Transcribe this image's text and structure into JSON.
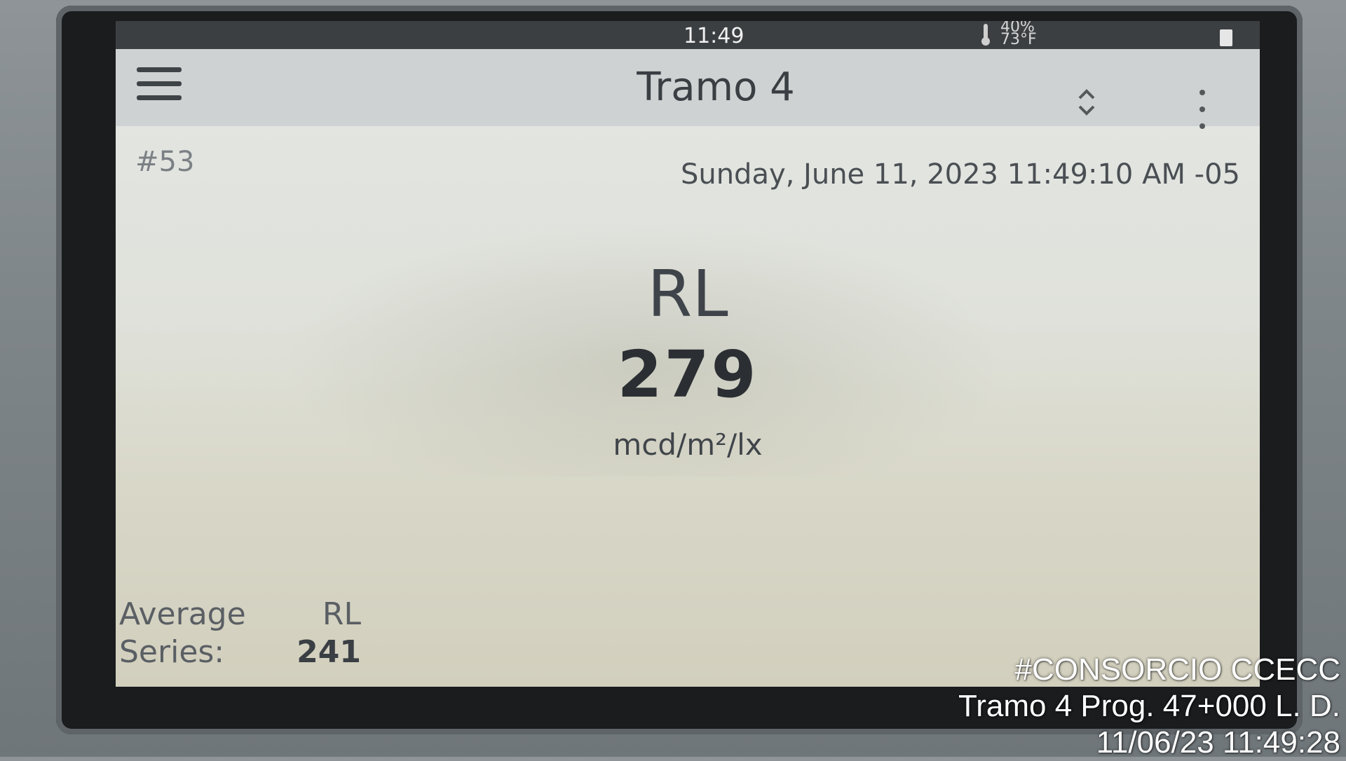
{
  "status_bar": {
    "time": "11:49",
    "humidity": "40%",
    "temperature": "73°F"
  },
  "app_bar": {
    "title": "Tramo 4"
  },
  "record": {
    "number": "#53",
    "datetime": "Sunday, June 11, 2023 11:49:10 AM -05"
  },
  "measurement": {
    "metric": "RL",
    "value": "279",
    "unit": "mcd/m²/lx"
  },
  "average": {
    "label_line1": "Average",
    "label_line2": "Series:",
    "metric": "RL",
    "value": "241"
  },
  "photo_overlay": {
    "line1": "#CONSORCIO CCECC",
    "line2": "Tramo 4 Prog. 47+000 L. D.",
    "line3": "11/06/23  11:49:28"
  },
  "icons": [
    "menu-icon",
    "thermometer-icon",
    "battery-icon",
    "sort-icon",
    "more-vert-icon"
  ]
}
